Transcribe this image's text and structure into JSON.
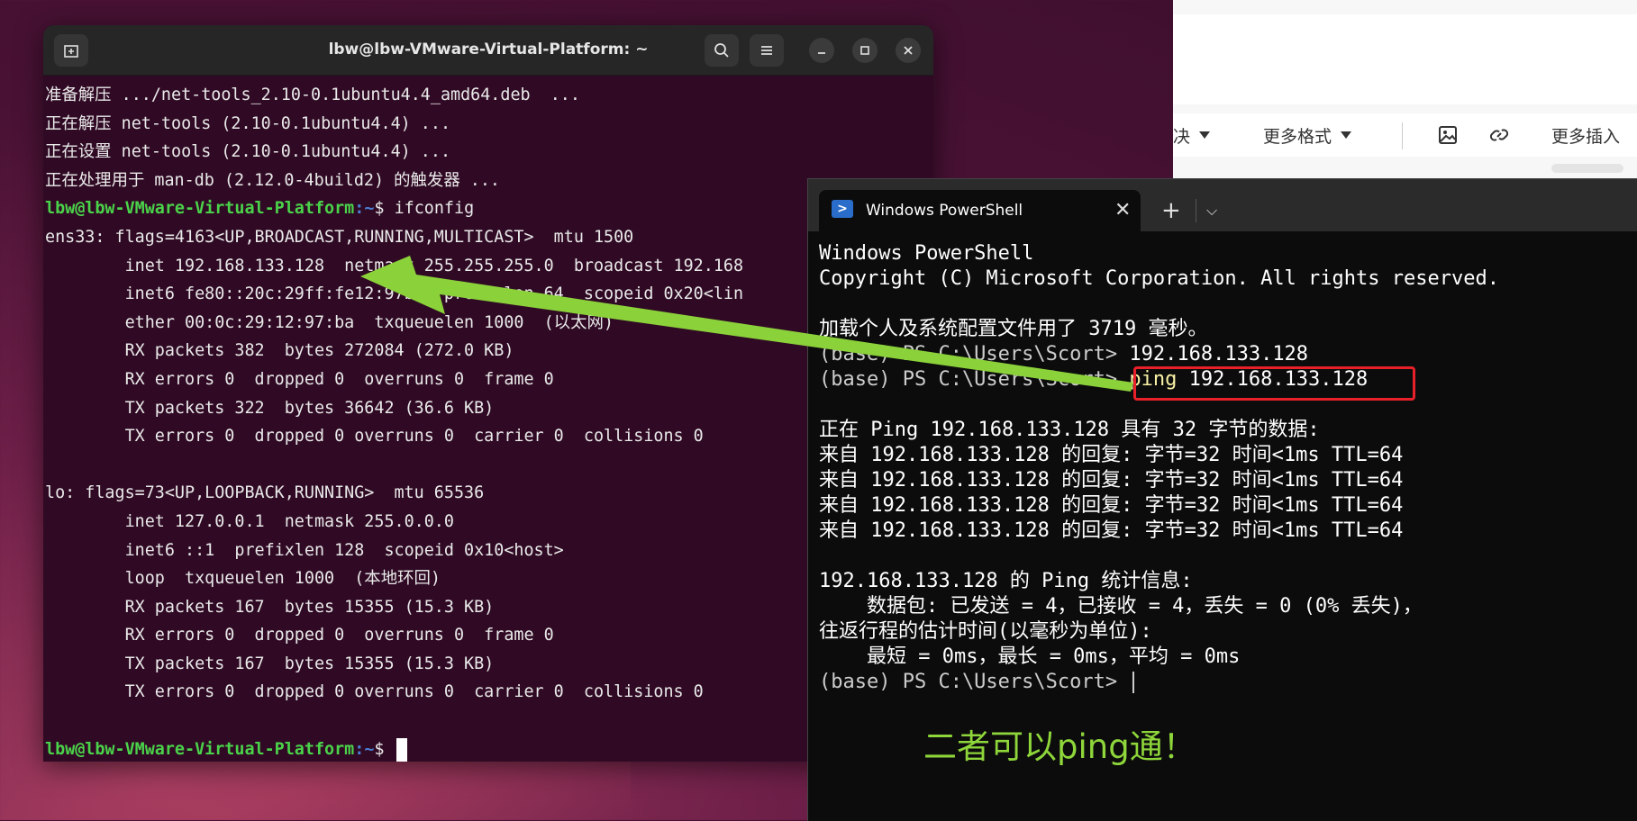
{
  "ubuntu_terminal": {
    "title": "lbw@lbw-VMware-Virtual-Platform: ~",
    "lines_before": [
      "准备解压 .../net-tools_2.10-0.1ubuntu4.4_amd64.deb  ...",
      "正在解压 net-tools (2.10-0.1ubuntu4.4) ...",
      "正在设置 net-tools (2.10-0.1ubuntu4.4) ...",
      "正在处理用于 man-db (2.12.0-4build2) 的触发器 ..."
    ],
    "prompt_user": "lbw@lbw-VMware-Virtual-Platform",
    "prompt_path": ":~",
    "prompt_symbol": "$ ",
    "command": "ifconfig",
    "output_lines": [
      "ens33: flags=4163<UP,BROADCAST,RUNNING,MULTICAST>  mtu 1500",
      "        inet 192.168.133.128  netmask 255.255.255.0  broadcast 192.168",
      "        inet6 fe80::20c:29ff:fe12:97ba  prefixlen 64  scopeid 0x20<lin",
      "        ether 00:0c:29:12:97:ba  txqueuelen 1000  (以太网)",
      "        RX packets 382  bytes 272084 (272.0 KB)",
      "        RX errors 0  dropped 0  overruns 0  frame 0",
      "        TX packets 322  bytes 36642 (36.6 KB)",
      "        TX errors 0  dropped 0 overruns 0  carrier 0  collisions 0",
      "",
      "lo: flags=73<UP,LOOPBACK,RUNNING>  mtu 65536",
      "        inet 127.0.0.1  netmask 255.0.0.0",
      "        inet6 ::1  prefixlen 128  scopeid 0x10<host>",
      "        loop  txqueuelen 1000  (本地环回)",
      "        RX packets 167  bytes 15355 (15.3 KB)",
      "        RX errors 0  dropped 0  overruns 0  frame 0",
      "        TX packets 167  bytes 15355 (15.3 KB)",
      "        TX errors 0  dropped 0 overruns 0  carrier 0  collisions 0",
      ""
    ]
  },
  "editor": {
    "partial_item": "决",
    "more_formats": "更多格式",
    "more_insert": "更多插入"
  },
  "powershell": {
    "tab_title": "Windows PowerShell",
    "close_glyph": "✕",
    "new_tab_glyph": "+",
    "dropdown_glyph": "⌵",
    "lines": [
      {
        "text": "Windows PowerShell",
        "style": "white"
      },
      {
        "text": "Copyright (C) Microsoft Corporation. All rights reserved.",
        "style": "white"
      },
      {
        "text": "",
        "style": "normal"
      },
      {
        "text": "加载个人及系统配置文件用了 3719 毫秒。",
        "style": "white"
      },
      {
        "prefix": "(base) PS C:\\Users\\Scort> ",
        "text": "192.168.133.128",
        "style": "white"
      },
      {
        "prefix": "(base) PS C:\\Users\\Scort> ",
        "cmd": "ping",
        "text": " 192.168.133.128",
        "style": "white"
      },
      {
        "text": "",
        "style": "normal"
      },
      {
        "text": "正在 Ping 192.168.133.128 具有 32 字节的数据:",
        "style": "white"
      },
      {
        "text": "来自 192.168.133.128 的回复: 字节=32 时间<1ms TTL=64",
        "style": "white"
      },
      {
        "text": "来自 192.168.133.128 的回复: 字节=32 时间<1ms TTL=64",
        "style": "white"
      },
      {
        "text": "来自 192.168.133.128 的回复: 字节=32 时间<1ms TTL=64",
        "style": "white"
      },
      {
        "text": "来自 192.168.133.128 的回复: 字节=32 时间<1ms TTL=64",
        "style": "white"
      },
      {
        "text": "",
        "style": "normal"
      },
      {
        "text": "192.168.133.128 的 Ping 统计信息:",
        "style": "white"
      },
      {
        "text": "    数据包: 已发送 = 4，已接收 = 4，丢失 = 0 (0% 丢失)，",
        "style": "white"
      },
      {
        "text": "往返行程的估计时间(以毫秒为单位):",
        "style": "white"
      },
      {
        "text": "    最短 = 0ms，最长 = 0ms，平均 = 0ms",
        "style": "white"
      },
      {
        "prefix": "(base) PS C:\\Users\\Scort> ",
        "text": "",
        "style": "white",
        "cursor": true
      }
    ],
    "caption": "二者可以ping通！"
  },
  "colors": {
    "arrow": "#8bd13a",
    "highlight": "#e8202a",
    "caption": "#8ed63a"
  }
}
